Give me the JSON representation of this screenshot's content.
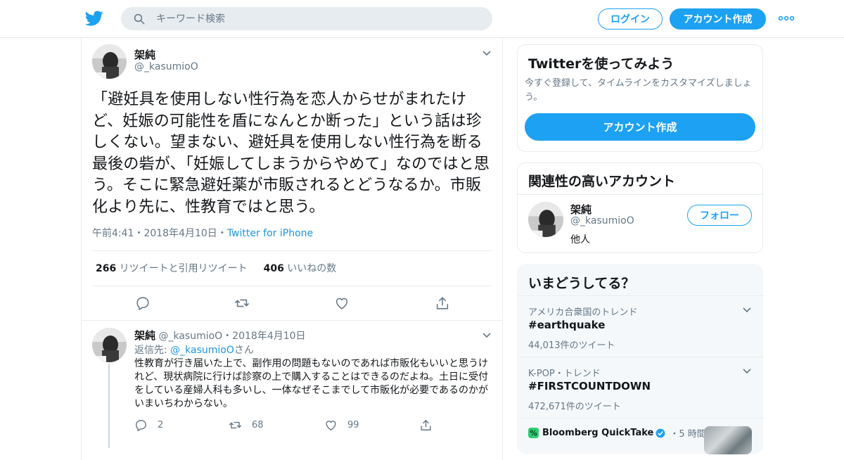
{
  "colors": {
    "brand": "#1da1f2",
    "link": "#1b95e0",
    "muted": "#657786",
    "text": "#14171a"
  },
  "header": {
    "logo_icon": "twitter-bird-icon",
    "search": {
      "placeholder": "キーワード検索",
      "icon": "search-icon"
    },
    "login_label": "ログイン",
    "signup_label": "アカウント作成",
    "more_icon": "more-dots-icon"
  },
  "tweet": {
    "author_name": "架純",
    "author_handle": "@_kasumioO",
    "text": "「避妊具を使用しない性行為を恋人からせがまれたけど、妊娠の可能性を盾になんとか断った」という話は珍しくない。望まない、避妊具を使用しない性行為を断る最後の砦が、「妊娠してしまうからやめて」なのではと思う。そこに緊急避妊薬が市販されるとどうなるか。市販化より先に、性教育ではと思う。",
    "time": "午前4:41",
    "date": "2018年4月10日",
    "source": "Twitter for iPhone",
    "retweet_count": "266",
    "retweet_label": "リツイートと引用リツイート",
    "like_count": "406",
    "like_label": "いいねの数",
    "actions": [
      "reply-icon",
      "retweet-icon",
      "like-icon",
      "share-icon"
    ]
  },
  "reply": {
    "author_name": "架純",
    "author_handle": "@_kasumioO",
    "date": "2018年4月10日",
    "reply_to_prefix": "返信先: ",
    "reply_to_handle": "@_kasumioO",
    "reply_to_suffix": "さん",
    "text": "性教育が行き届いた上で、副作用の問題もないのであれば市販化もいいと思うけれど、現状病院に行けば診察の上で購入することはできるのだよね。土日に受付をしている産婦人科も多いし、一体なぜそこまでして市販化が必要であるのかがいまいちわからない。",
    "reply_count": "2",
    "retweet_count": "68",
    "like_count": "99"
  },
  "sidebar": {
    "signup_card": {
      "title": "Twitterを使ってみよう",
      "subtitle": "今すぐ登録して、タイムラインをカスタマイズしましょう。",
      "cta": "アカウント作成"
    },
    "related_card": {
      "title": "関連性の高いアカウント",
      "name": "架純",
      "handle": "@_kasumioO",
      "bio": "他人",
      "follow_label": "フォロー"
    },
    "trends_card": {
      "title": "いまどうしてる？",
      "trends": [
        {
          "context": "アメリカ合衆国のトレンド",
          "name": "#earthquake",
          "count": "44,013件のツイート"
        },
        {
          "context": "K-POP・トレンド",
          "name": "#FIRSTCOUNTDOWN",
          "count": "472,671件のツイート"
        }
      ],
      "news": {
        "source": "Bloomberg QuickTake",
        "time": "・5 時間前"
      }
    }
  }
}
